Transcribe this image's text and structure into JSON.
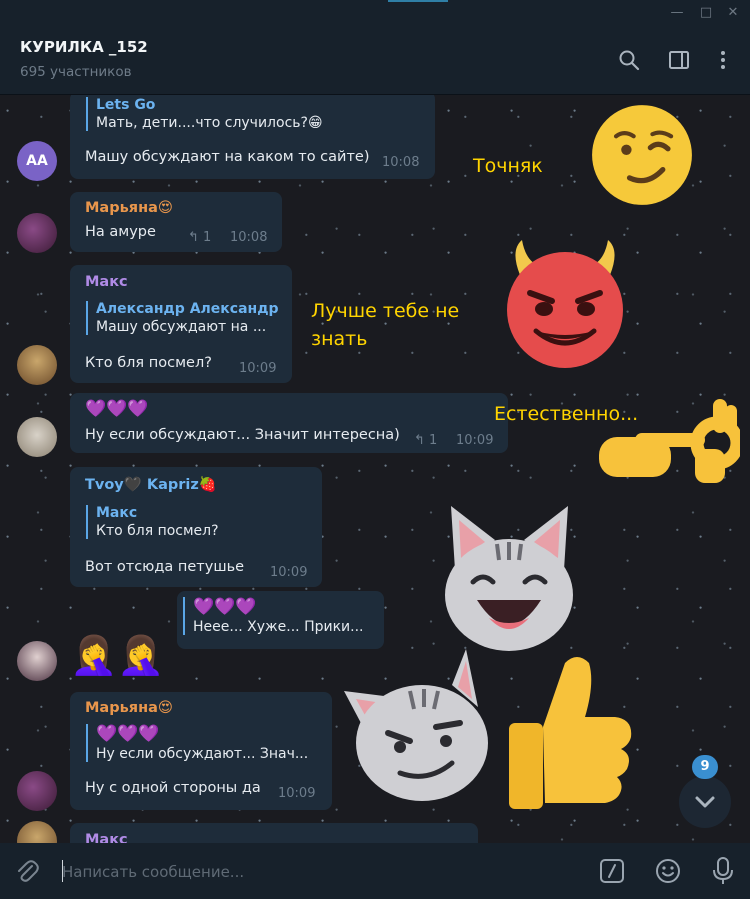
{
  "window": {
    "minimize": "—",
    "maximize": "□",
    "close": "✕"
  },
  "header": {
    "title": "КУРИЛКА _152",
    "subtitle": "695 участников"
  },
  "messages": [
    {
      "reply_name": "Lets Go",
      "reply_text": "Мать, дети....что случилось?😁",
      "text": "Машу обсуждают на каком то сайте)",
      "time": "10:08",
      "avatar_initials": "AA"
    },
    {
      "sender": "Марьяна😍",
      "text": "На амуре",
      "replies": "1",
      "time": "10:08"
    },
    {
      "sender": "Макс",
      "reply_name": "Александр Александр",
      "reply_text": "Машу обсуждают на ...",
      "text": "Кто бля посмел?",
      "time": "10:09"
    },
    {
      "hearts": "💜💜💜",
      "text": "Ну если обсуждают... Значит интересна)",
      "replies": "1",
      "time": "10:09"
    },
    {
      "sender": "Tvoy🖤 Kapriz🍓",
      "reply_name": "Макс",
      "reply_text": "Кто бля посмел?",
      "text": "Вот отсюда петушье",
      "time": "10:09"
    },
    {
      "reply_hearts": "💜💜💜",
      "reply_text": "Неее... Хуже... Прики..."
    },
    {
      "emoji": "🤦‍♀️🤦‍♀️"
    },
    {
      "sender": "Марьяна😍",
      "reply_hearts": "💜💜💜",
      "reply_text": "Ну если обсуждают... Знач...",
      "text": "Ну с одной стороны да",
      "time": "10:09"
    },
    {
      "sender": "Макс"
    }
  ],
  "stickers": {
    "s1": "Точняк",
    "s2_line1": "Лучше тебе не",
    "s2_line2": "знать",
    "s3": "Естественно..."
  },
  "composer": {
    "placeholder": "Написать сообщение..."
  },
  "scroll": {
    "unread_count": "9"
  },
  "colors": {
    "accent": "#3a8fd0",
    "bubble": "#1e2c3a",
    "sticker_text": "#ffd400",
    "orange_name": "#e8964c",
    "purple_name": "#b08be6",
    "blue_name": "#6cb3f0"
  }
}
